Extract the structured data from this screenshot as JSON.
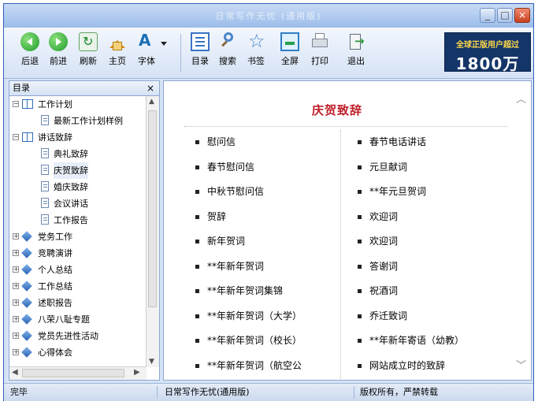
{
  "window": {
    "title": "日常写作无忧 (通用版)"
  },
  "toolbar": {
    "buttons": [
      {
        "label": "后退",
        "icon": "back-arrow-icon"
      },
      {
        "label": "前进",
        "icon": "forward-arrow-icon"
      },
      {
        "label": "刷新",
        "icon": "refresh-icon"
      },
      {
        "label": "主页",
        "icon": "home-icon"
      },
      {
        "label": "字体",
        "icon": "font-icon"
      },
      {
        "label": "目录",
        "icon": "toc-icon"
      },
      {
        "label": "搜索",
        "icon": "search-icon"
      },
      {
        "label": "书签",
        "icon": "bookmark-star-icon"
      },
      {
        "label": "全屏",
        "icon": "fullscreen-icon"
      },
      {
        "label": "打印",
        "icon": "printer-icon"
      },
      {
        "label": "退出",
        "icon": "exit-icon"
      }
    ]
  },
  "banner": {
    "line1": "全球正版用户超过",
    "line2": "1800万"
  },
  "toc": {
    "header": "目录",
    "close": "×",
    "items": [
      {
        "label": "工作计划",
        "kind": "folder",
        "expanded": true
      },
      {
        "label": "最新工作计划样例",
        "kind": "page"
      },
      {
        "label": "讲话致辞",
        "kind": "folder",
        "expanded": true
      },
      {
        "label": "典礼致辞",
        "kind": "page"
      },
      {
        "label": "庆贺致辞",
        "kind": "page",
        "selected": true
      },
      {
        "label": "婚庆致辞",
        "kind": "page"
      },
      {
        "label": "会议讲话",
        "kind": "page"
      },
      {
        "label": "工作报告",
        "kind": "page"
      },
      {
        "label": "党务工作",
        "kind": "collapsed"
      },
      {
        "label": "竞聘演讲",
        "kind": "collapsed"
      },
      {
        "label": "个人总结",
        "kind": "collapsed"
      },
      {
        "label": "工作总结",
        "kind": "collapsed"
      },
      {
        "label": "述职报告",
        "kind": "collapsed"
      },
      {
        "label": "八荣八耻专题",
        "kind": "collapsed"
      },
      {
        "label": "党员先进性活动",
        "kind": "collapsed"
      },
      {
        "label": "心得体会",
        "kind": "collapsed"
      }
    ]
  },
  "content": {
    "title": "庆贺致辞",
    "left_items": [
      "慰问信",
      "春节慰问信",
      "中秋节慰问信",
      "贺辞",
      "新年贺词",
      "**年新年贺词",
      "**年新年贺词集锦",
      "**年新年贺词（大学）",
      "**年新年贺词（校长）",
      "**年新年贺词（航空公"
    ],
    "right_items": [
      "春节电话讲话",
      "元旦献词",
      "**年元旦贺词",
      "欢迎词",
      "欢迎词",
      "答谢词",
      "祝酒词",
      "乔迁致词",
      "**年新年寄语（幼教）",
      "网站成立时的致辞"
    ]
  },
  "status": {
    "left": "完毕",
    "middle": "日常写作无忧(通用版)",
    "right": "版权所有，严禁转载"
  },
  "colors": {
    "title_red": "#c0202a",
    "frame_blue": "#2f5fb6"
  }
}
